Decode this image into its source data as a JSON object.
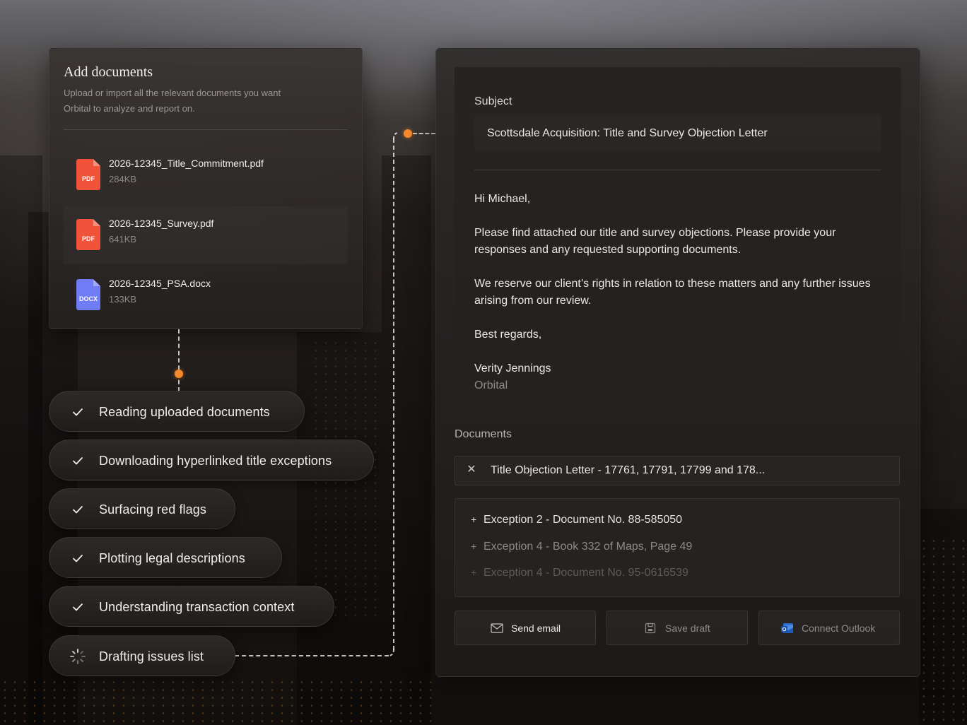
{
  "add_documents": {
    "title": "Add documents",
    "subtitle": "Upload or import all the relevant documents you want Orbital to analyze and report on.",
    "files": [
      {
        "type": "PDF",
        "name": "2026-12345_Title_Commitment.pdf",
        "size": "284KB"
      },
      {
        "type": "PDF",
        "name": "2026-12345_Survey.pdf",
        "size": "641KB"
      },
      {
        "type": "DOCX",
        "name": "2026-12345_PSA.docx",
        "size": "133KB"
      }
    ]
  },
  "steps": [
    {
      "label": "Reading uploaded documents",
      "status": "done"
    },
    {
      "label": "Downloading hyperlinked title exceptions",
      "status": "done"
    },
    {
      "label": "Surfacing red flags",
      "status": "done"
    },
    {
      "label": "Plotting legal descriptions",
      "status": "done"
    },
    {
      "label": "Understanding transaction context",
      "status": "done"
    },
    {
      "label": "Drafting issues list",
      "status": "in-progress"
    }
  ],
  "email": {
    "subject_label": "Subject",
    "subject": "Scottsdale Acquisition: Title and Survey Objection Letter",
    "greeting": "Hi Michael,",
    "paragraph1": "Please find attached our title and survey objections. Please provide your responses and any requested supporting documents.",
    "paragraph2": "We reserve our client’s rights in relation to these matters and any further issues arising from our review.",
    "closing": "Best regards,",
    "sender_name": "Verity Jennings",
    "sender_org": "Orbital"
  },
  "documents": {
    "label": "Documents",
    "attached": "Title Objection Letter - 17761, 17791, 17799 and 178...",
    "exceptions": [
      "Exception 2 - Document No. 88-585050",
      "Exception 4 - Book 332 of Maps, Page 49",
      "Exception 4 - Document No. 95-0616539"
    ]
  },
  "actions": {
    "send": "Send email",
    "save": "Save draft",
    "connect": "Connect Outlook"
  },
  "colors": {
    "accent_orange": "#f7892d",
    "pdf_red": "#f0533a",
    "docx_blue": "#6f7cf5",
    "outlook_blue": "#2f6fd1"
  }
}
